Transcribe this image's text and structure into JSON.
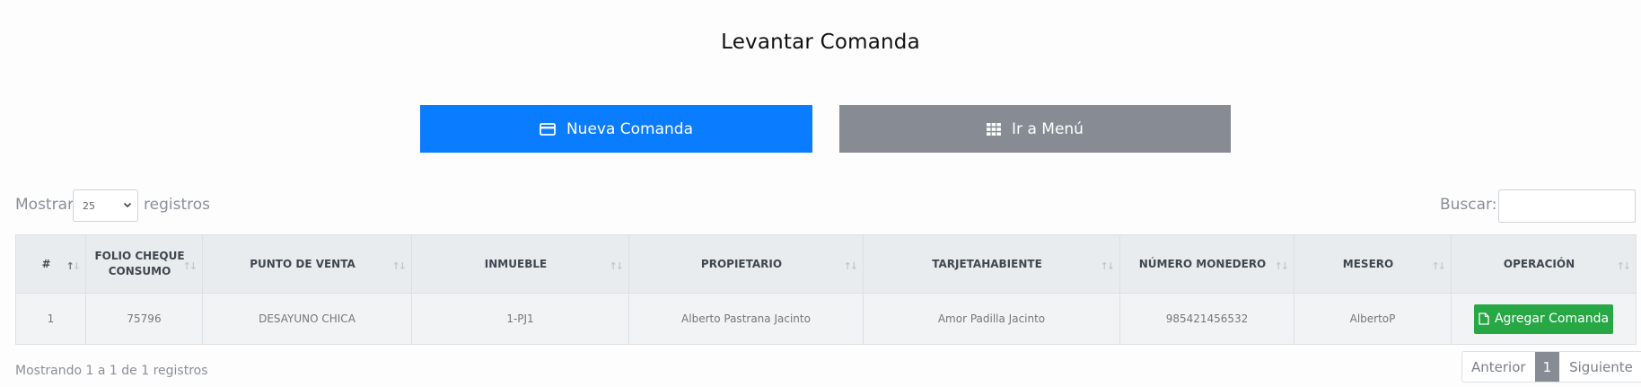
{
  "page": {
    "title": "Levantar Comanda"
  },
  "actions": {
    "new_order": {
      "label": "Nueva Comanda",
      "icon": "credit-card-icon",
      "color": "#0a7cff"
    },
    "go_menu": {
      "label": "Ir a Menú",
      "icon": "grid-icon",
      "color": "#878c94"
    }
  },
  "length_control": {
    "prefix": "Mostrar",
    "value": "25",
    "suffix": "registros"
  },
  "search": {
    "label": "Buscar:",
    "value": ""
  },
  "table": {
    "headers": [
      "#",
      "FOLIO CHEQUE CONSUMO",
      "PUNTO DE VENTA",
      "INMUEBLE",
      "PROPIETARIO",
      "TARJETAHABIENTE",
      "NÚMERO MONEDERO",
      "MESERO",
      "OPERACIÓN"
    ],
    "rows": [
      {
        "num": "1",
        "folio": "75796",
        "punto_venta": "DESAYUNO CHICA",
        "inmueble": "1-PJ1",
        "propietario": "Alberto Pastrana Jacinto",
        "tarjetahabiente": "Amor Padilla Jacinto",
        "monedero": "985421456532",
        "mesero": "AlbertoP",
        "operacion": {
          "label": "Agregar Comanda",
          "icon": "file-icon",
          "color": "#28a745"
        }
      }
    ]
  },
  "footer": {
    "info": "Mostrando 1 a 1 de 1 registros",
    "pagination": {
      "prev": "Anterior",
      "current": "1",
      "next": "Siguiente"
    }
  }
}
